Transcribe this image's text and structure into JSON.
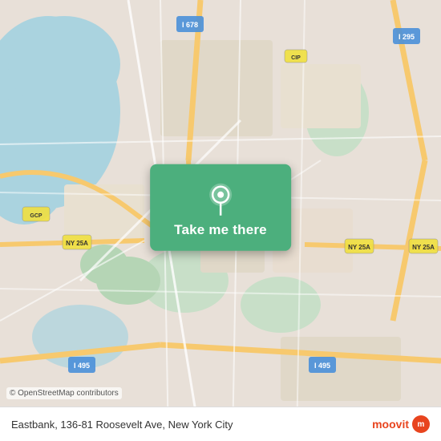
{
  "map": {
    "background_color": "#e8e0d8",
    "copyright": "© OpenStreetMap contributors"
  },
  "action_card": {
    "button_label": "Take me there",
    "pin_icon": "location-pin-icon"
  },
  "bottom_bar": {
    "address": "Eastbank, 136-81 Roosevelt Ave, New York City",
    "logo_text": "moovit",
    "logo_icon": "m"
  }
}
